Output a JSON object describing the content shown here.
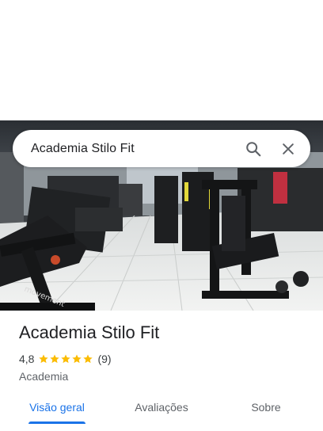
{
  "search": {
    "query": "Academia Stilo Fit",
    "search_icon": "search-icon",
    "close_icon": "close-icon"
  },
  "photo": {
    "treadmill_brand": "movement"
  },
  "place": {
    "name": "Academia Stilo Fit",
    "rating": "4,8",
    "stars": 5,
    "review_count": "(9)",
    "category": "Academia"
  },
  "tabs": [
    {
      "label": "Visão geral",
      "active": true
    },
    {
      "label": "Avaliações",
      "active": false
    },
    {
      "label": "Sobre",
      "active": false
    }
  ],
  "colors": {
    "accent": "#1a73e8",
    "star": "#fbbc04",
    "text_primary": "#202124",
    "text_secondary": "#5f6368"
  }
}
